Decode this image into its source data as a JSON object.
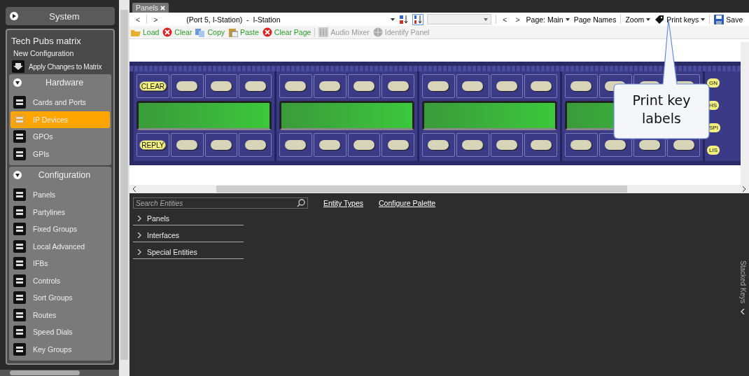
{
  "sidebar": {
    "system": {
      "title": "System",
      "expanded": false
    },
    "group": {
      "title": "Tech Pubs matrix",
      "subtitle": "New Configuration",
      "action": "Apply Changes to Matrix",
      "sections": [
        {
          "title": "Hardware",
          "expanded": true,
          "items": [
            {
              "label": "Cards and Ports",
              "selected": false
            },
            {
              "label": "IP Devices",
              "selected": true
            },
            {
              "label": "GPOs",
              "selected": false
            },
            {
              "label": "GPIs",
              "selected": false
            }
          ]
        },
        {
          "title": "Configuration",
          "expanded": true,
          "items": [
            {
              "label": "Panels",
              "selected": false
            },
            {
              "label": "Partylines",
              "selected": false
            },
            {
              "label": "Fixed Groups",
              "selected": false
            },
            {
              "label": "Local Advanced",
              "selected": false
            },
            {
              "label": "IFBs",
              "selected": false
            },
            {
              "label": "Controls",
              "selected": false
            },
            {
              "label": "Sort Groups",
              "selected": false
            },
            {
              "label": "Routes",
              "selected": false
            },
            {
              "label": "Speed Dials",
              "selected": false
            },
            {
              "label": "Key Groups",
              "selected": false
            }
          ]
        }
      ]
    }
  },
  "document_tab": {
    "label": "Panels"
  },
  "toolbar": {
    "back": "<",
    "forward": ">",
    "device": "(Port 5, I-Station)  -  I-Station",
    "page_prev": "<",
    "page_next": ">",
    "menus": [
      {
        "label": "Page: Main",
        "kind": "dropdown"
      },
      {
        "label": "Page Names",
        "kind": "button"
      },
      {
        "label": "Zoom",
        "kind": "dropdown"
      },
      {
        "label": "Print keys",
        "kind": "dropdown"
      },
      {
        "label": "Save",
        "kind": "button"
      }
    ]
  },
  "actions": [
    {
      "label": "Load",
      "disabled": false
    },
    {
      "label": "Clear",
      "disabled": false
    },
    {
      "label": "Copy",
      "disabled": false
    },
    {
      "label": "Paste",
      "disabled": false
    },
    {
      "label": "Clear Page",
      "disabled": false
    },
    {
      "label": "Audio Mixer",
      "disabled": true
    },
    {
      "label": "Identify Panel",
      "disabled": true
    }
  ],
  "panel": {
    "modules": [
      {
        "top_keys": [
          {
            "label": "CLEAR",
            "lit": true
          },
          {
            "lit": false
          },
          {
            "lit": false
          },
          {
            "lit": false
          }
        ],
        "bottom_keys": [
          {
            "label": "REPLY",
            "lit": true
          },
          {
            "lit": false
          },
          {
            "lit": false
          },
          {
            "lit": false
          }
        ]
      },
      {
        "top_keys": [
          {
            "lit": false
          },
          {
            "lit": false
          },
          {
            "lit": false
          },
          {
            "lit": false
          }
        ],
        "bottom_keys": [
          {
            "lit": false
          },
          {
            "lit": false
          },
          {
            "lit": false
          },
          {
            "lit": false
          }
        ]
      },
      {
        "top_keys": [
          {
            "lit": false
          },
          {
            "lit": false
          },
          {
            "lit": false
          },
          {
            "lit": false
          }
        ],
        "bottom_keys": [
          {
            "lit": false
          },
          {
            "lit": false
          },
          {
            "lit": false
          },
          {
            "lit": false
          }
        ]
      },
      {
        "top_keys": [
          {
            "lit": false
          },
          {
            "lit": false
          },
          {
            "lit": false
          },
          {
            "lit": false
          }
        ],
        "bottom_keys": [
          {
            "lit": false
          },
          {
            "lit": false
          },
          {
            "lit": false
          },
          {
            "lit": false
          }
        ]
      }
    ],
    "side_keys": [
      "GN",
      "HS",
      "SPI",
      "LIS"
    ]
  },
  "callout": {
    "text": "Print key labels"
  },
  "entities": {
    "search": {
      "placeholder": "Search Entities"
    },
    "links": [
      "Entity Types",
      "Configure Palette"
    ],
    "groups": [
      {
        "label": "Panels",
        "expanded": false
      },
      {
        "label": "Interfaces",
        "expanded": false
      },
      {
        "label": "Special Entities",
        "expanded": false
      }
    ]
  },
  "stacked_keys": {
    "label": "Stacked Keys",
    "expanded": false
  }
}
